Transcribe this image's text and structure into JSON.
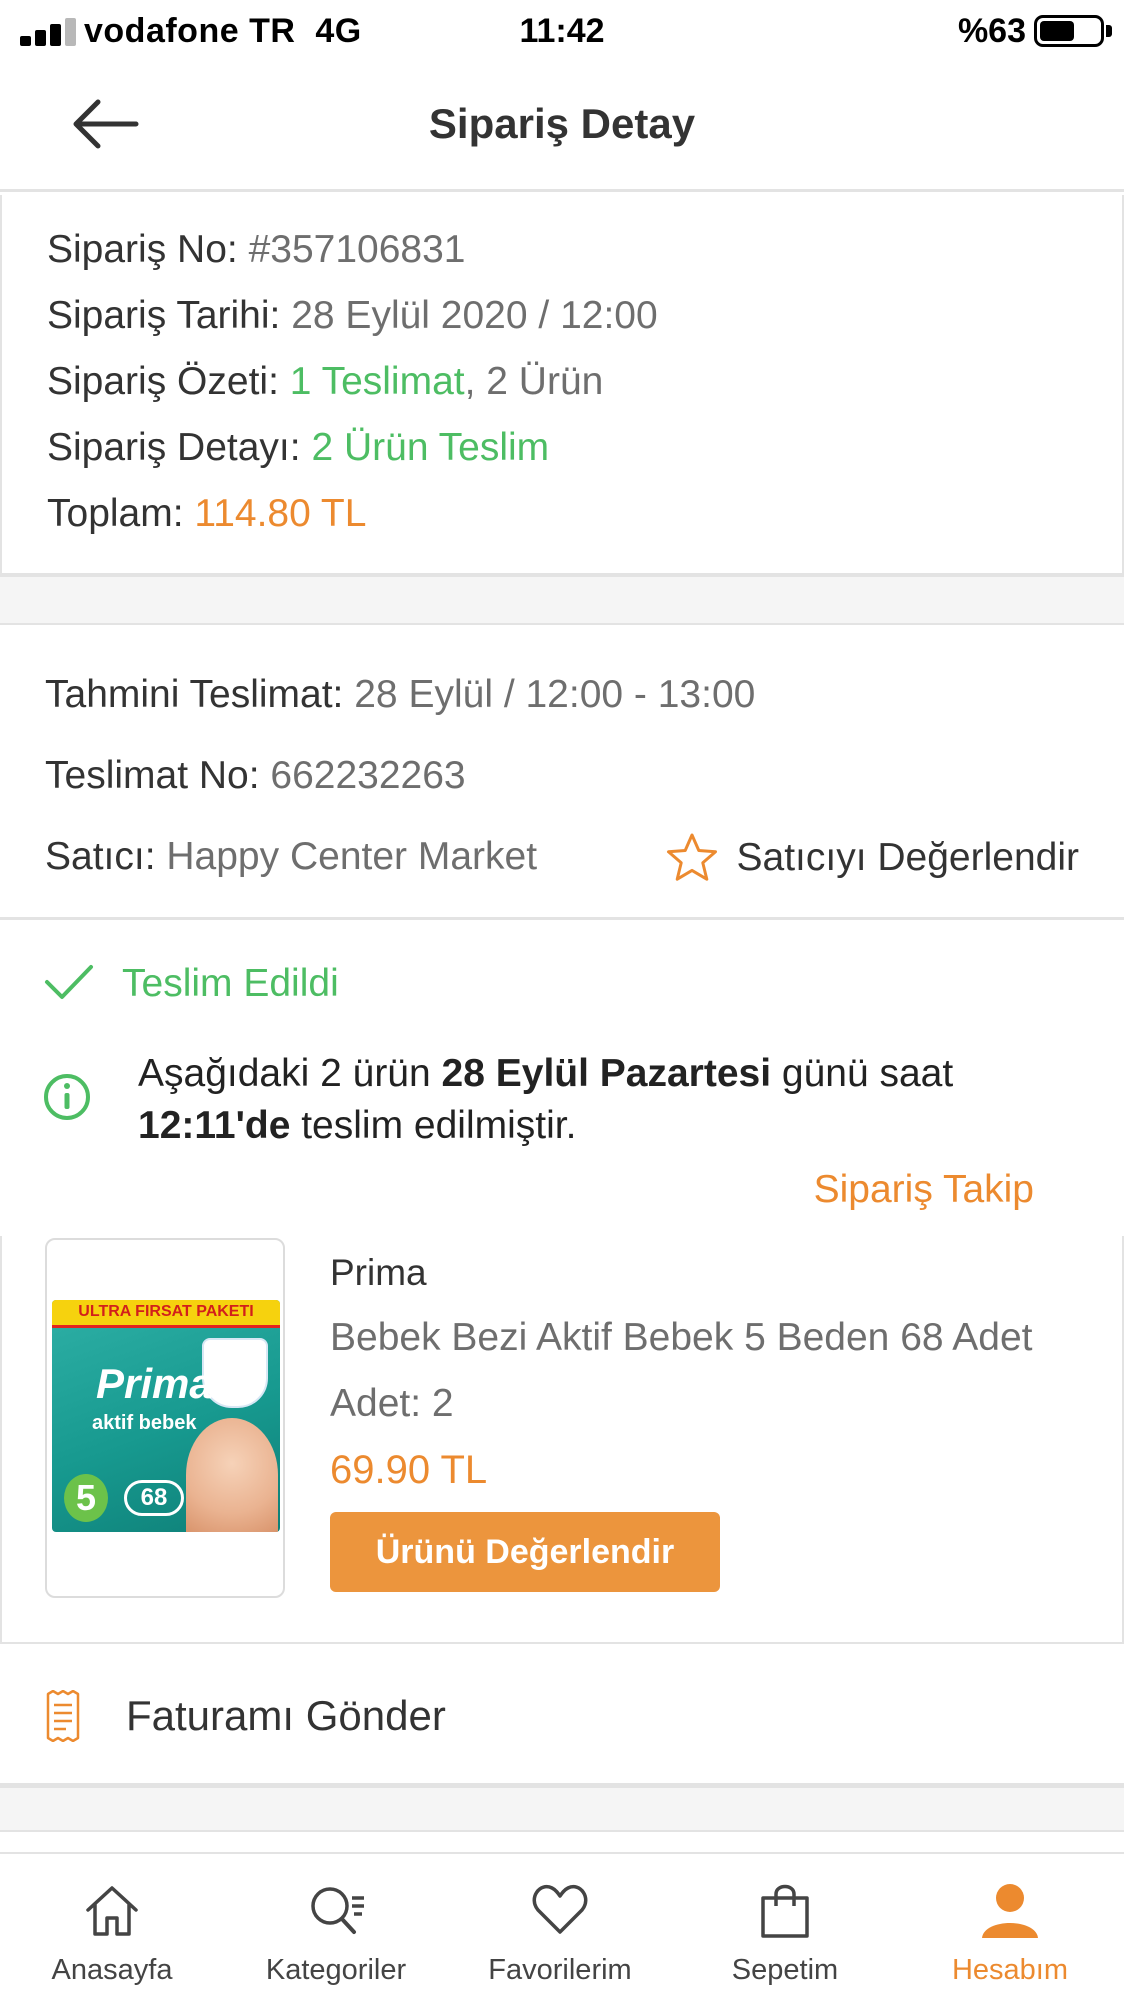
{
  "status_bar": {
    "carrier": "vodafone TR",
    "network": "4G",
    "time": "11:42",
    "battery": "%63",
    "battery_level": 0.63
  },
  "header": {
    "title": "Sipariş Detay",
    "back_icon": "arrow-left-icon"
  },
  "summary": {
    "order_no_label": "Sipariş No:",
    "order_no": "#357106831",
    "order_date_label": "Sipariş Tarihi:",
    "order_date": "28 Eylül 2020 / 12:00",
    "order_summary_label": "Sipariş Özeti:",
    "order_summary_delivery": "1 Teslimat",
    "order_summary_items": ", 2 Ürün",
    "order_detail_label": "Sipariş Detayı:",
    "order_detail": "2 Ürün Teslim",
    "total_label": "Toplam:",
    "total": "114.80 TL"
  },
  "delivery": {
    "eta_label": "Tahmini Teslimat:",
    "eta": "28 Eylül / 12:00 - 13:00",
    "delivery_no_label": "Teslimat No:",
    "delivery_no": "662232263",
    "seller_label": "Satıcı:",
    "seller": "Happy Center Market",
    "rate_seller": "Satıcıyı Değerlendir",
    "rate_seller_icon": "star-outline-icon"
  },
  "status": {
    "label": "Teslim Edildi",
    "icon": "check-icon",
    "info_icon": "info-circle-icon",
    "info_part1": "Aşağıdaki 2 ürün ",
    "info_bold1": "28 Eylül Pazartesi",
    "info_part2": " günü saat ",
    "info_bold2": "12:11'de",
    "info_part3": " teslim edilmiştir.",
    "track_link": "Sipariş Takip"
  },
  "product": {
    "brand": "Prima",
    "name": "Bebek Bezi Aktif Bebek 5 Beden 68 Adet",
    "qty_label": "Adet:",
    "qty": "2",
    "price": "69.90 TL",
    "rate_button": "Ürünü Değerlendir",
    "image": {
      "banner": "ULTRA FIRSAT PAKETI",
      "brand": "Prima",
      "subtitle": "aktif bebek",
      "size": "5",
      "count": "68"
    }
  },
  "invoice": {
    "label": "Faturamı Gönder",
    "icon": "receipt-icon"
  },
  "tabbar": {
    "items": [
      {
        "label": "Anasayfa",
        "icon": "home-icon",
        "active": false
      },
      {
        "label": "Kategoriler",
        "icon": "search-list-icon",
        "active": false
      },
      {
        "label": "Favorilerim",
        "icon": "heart-icon",
        "active": false
      },
      {
        "label": "Sepetim",
        "icon": "shopping-bag-icon",
        "active": false
      },
      {
        "label": "Hesabım",
        "icon": "user-icon",
        "active": true
      }
    ]
  },
  "colors": {
    "accent_orange": "#ec8a2f",
    "success_green": "#4dbd63",
    "button_orange": "#ec953d"
  }
}
